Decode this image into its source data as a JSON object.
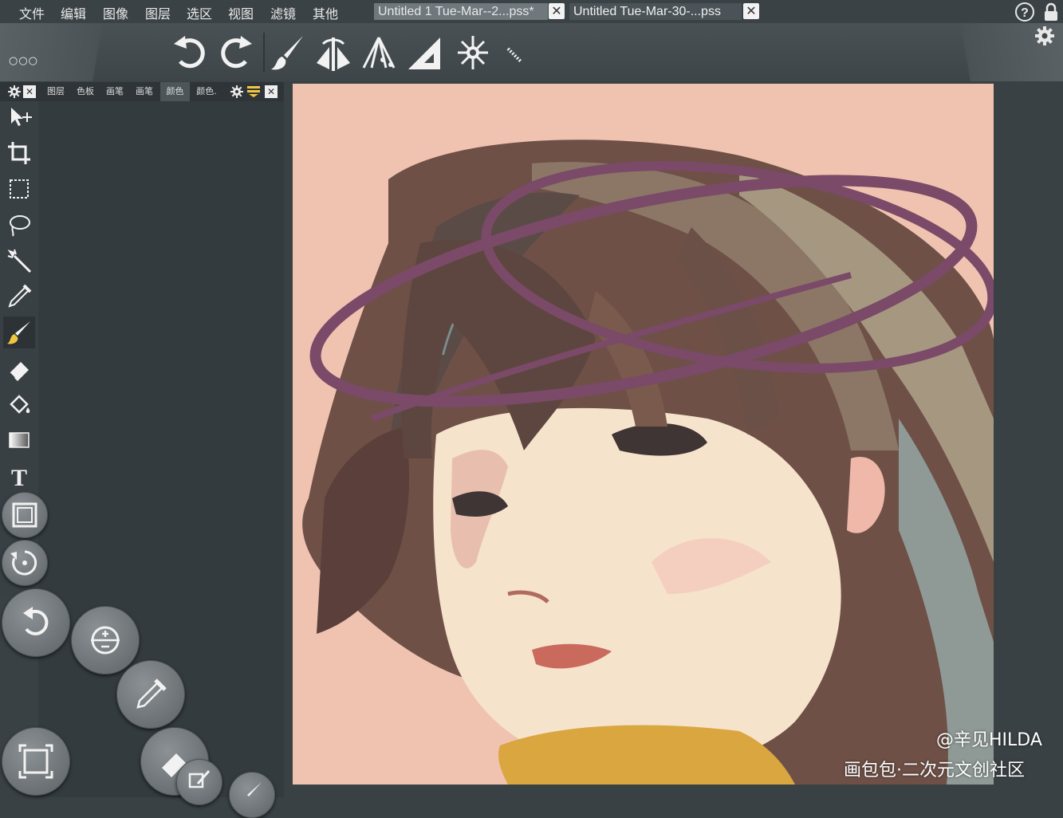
{
  "menu": {
    "items": [
      "文件",
      "编辑",
      "图像",
      "图层",
      "选区",
      "视图",
      "滤镜",
      "其他"
    ]
  },
  "documents": [
    {
      "title": "Untitled 1 Tue-Mar--2...pss*",
      "active": true
    },
    {
      "title": "Untitled Tue-Mar-30-...pss",
      "active": false
    }
  ],
  "top_right": {
    "help_icon": "help-circle-icon",
    "lock_icon": "lock-icon",
    "settings_icon": "gear-icon"
  },
  "toolbar": {
    "more_label": "○○○",
    "buttons": [
      "undo-icon",
      "redo-icon",
      "brush-icon",
      "symmetry-icon",
      "perspective-icon",
      "ruler-icon",
      "kaleidoscope-icon",
      "pencil-icon"
    ]
  },
  "panel": {
    "tabs": [
      "图层",
      "色板",
      "画笔",
      "画笔",
      "颜色",
      "颜色."
    ],
    "selected_tab": "颜色"
  },
  "tools": [
    {
      "name": "move-icon",
      "selected": false
    },
    {
      "name": "crop-icon",
      "selected": false
    },
    {
      "name": "marquee-select-icon",
      "selected": false
    },
    {
      "name": "lasso-icon",
      "selected": false
    },
    {
      "name": "magic-wand-icon",
      "selected": false
    },
    {
      "name": "eyedropper-icon",
      "selected": false
    },
    {
      "name": "brush-icon",
      "selected": true
    },
    {
      "name": "eraser-icon",
      "selected": false
    },
    {
      "name": "fill-bucket-icon",
      "selected": false
    },
    {
      "name": "gradient-icon",
      "selected": false
    },
    {
      "name": "text-icon",
      "selected": false
    }
  ],
  "text_tool_glyph": "T",
  "floating_buttons": [
    "frame-icon",
    "rotate-view-icon",
    "undo-icon",
    "adjust-icon",
    "eyedropper-icon",
    "fit-screen-icon",
    "eraser-icon",
    "copy-icon",
    "brush-icon"
  ],
  "canvas": {
    "background": "#f0c3b0",
    "content": "painted anime girl portrait"
  },
  "colors": {
    "accent_halo": "#7a4a68",
    "hair": "#6a4a40",
    "skin": "#f6e3cc",
    "collar": "#d9a640"
  },
  "watermark": {
    "line1": "@辛见HILDA",
    "line2": "画包包·二次元文创社区"
  }
}
